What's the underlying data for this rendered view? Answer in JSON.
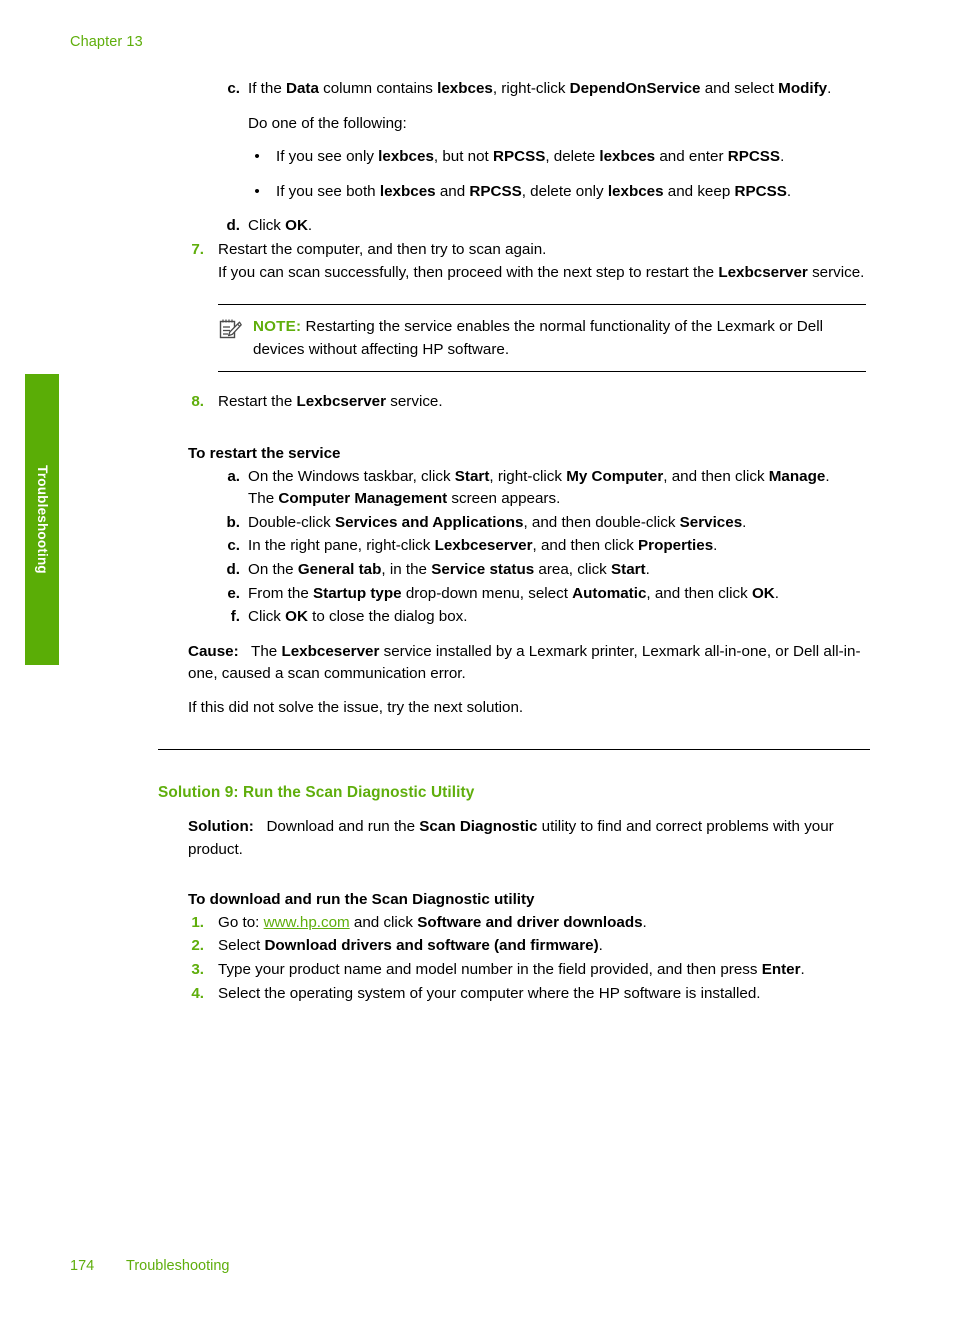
{
  "page": {
    "chapter_header": "Chapter 13",
    "footer_page_number": "174",
    "footer_section": "Troubleshooting",
    "side_tab_label": "Troubleshooting",
    "accent_green": "#5FAE0C",
    "tab_green": "#5AAD06"
  },
  "step_c": {
    "marker": "c.",
    "line1_a": "If the ",
    "line1_b": "Data",
    "line1_c": " column contains ",
    "line1_d": "lexbces",
    "line1_e": ", right-click ",
    "line1_f": "DependOnService",
    "line1_g": " and select ",
    "line1_h": "Modify",
    "line1_i": "."
  },
  "do_one_of": "Do one of the following:",
  "bullets": [
    {
      "marker": "•",
      "a": "If you see only ",
      "b": "lexbces",
      "c": ", but not ",
      "d": "RPCSS",
      "e": ", delete ",
      "f": "lexbces",
      "g": " and enter ",
      "h": "RPCSS",
      "i": "."
    },
    {
      "marker": "•",
      "a": "If you see both ",
      "b": "lexbces",
      "c": " and ",
      "d": "RPCSS",
      "e": ", delete only ",
      "f": "lexbces",
      "g": " and keep ",
      "h": "RPCSS",
      "i": "."
    }
  ],
  "step_d": {
    "marker": "d.",
    "a": "Click ",
    "b": "OK",
    "c": "."
  },
  "step_7": {
    "marker": "7.",
    "text": "Restart the computer, and then try to scan again.",
    "cont_a": "If you can scan successfully, then proceed with the next step to restart the ",
    "cont_b": "Lexbcserver",
    "cont_c": " service."
  },
  "note": {
    "icon": "note-pad-pencil-icon",
    "label": "NOTE:",
    "text": "Restarting the service enables the normal functionality of the Lexmark or Dell devices without affecting HP software."
  },
  "step_8": {
    "marker": "8.",
    "a": "Restart the ",
    "b": "Lexbcserver",
    "c": " service."
  },
  "restart_service": {
    "heading": "To restart the service",
    "items": [
      {
        "marker": "a.",
        "parts": [
          {
            "t": "On the Windows taskbar, click ",
            "bold": false
          },
          {
            "t": "Start",
            "bold": true
          },
          {
            "t": ", right-click ",
            "bold": false
          },
          {
            "t": "My Computer",
            "bold": true
          },
          {
            "t": ", and then click ",
            "bold": false
          },
          {
            "t": "Manage",
            "bold": true
          },
          {
            "t": ".",
            "bold": false
          }
        ],
        "continuation": [
          {
            "t": "The ",
            "bold": false
          },
          {
            "t": "Computer Management",
            "bold": true
          },
          {
            "t": " screen appears.",
            "bold": false
          }
        ]
      },
      {
        "marker": "b.",
        "parts": [
          {
            "t": "Double-click ",
            "bold": false
          },
          {
            "t": "Services and Applications",
            "bold": true
          },
          {
            "t": ", and then double-click ",
            "bold": false
          },
          {
            "t": "Services",
            "bold": true
          },
          {
            "t": ".",
            "bold": false
          }
        ]
      },
      {
        "marker": "c.",
        "parts": [
          {
            "t": "In the right pane, right-click ",
            "bold": false
          },
          {
            "t": "Lexbceserver",
            "bold": true
          },
          {
            "t": ", and then click ",
            "bold": false
          },
          {
            "t": "Properties",
            "bold": true
          },
          {
            "t": ".",
            "bold": false
          }
        ]
      },
      {
        "marker": "d.",
        "parts": [
          {
            "t": "On the ",
            "bold": false
          },
          {
            "t": "General tab",
            "bold": true
          },
          {
            "t": ", in the ",
            "bold": false
          },
          {
            "t": "Service status",
            "bold": true
          },
          {
            "t": " area, click ",
            "bold": false
          },
          {
            "t": "Start",
            "bold": true
          },
          {
            "t": ".",
            "bold": false
          }
        ]
      },
      {
        "marker": "e.",
        "parts": [
          {
            "t": "From the ",
            "bold": false
          },
          {
            "t": "Startup type",
            "bold": true
          },
          {
            "t": " drop-down menu, select ",
            "bold": false
          },
          {
            "t": "Automatic",
            "bold": true
          },
          {
            "t": ", and then click ",
            "bold": false
          },
          {
            "t": "OK",
            "bold": true
          },
          {
            "t": ".",
            "bold": false
          }
        ]
      },
      {
        "marker": "f.",
        "parts": [
          {
            "t": "Click ",
            "bold": false
          },
          {
            "t": "OK",
            "bold": true
          },
          {
            "t": " to close the dialog box.",
            "bold": false
          }
        ]
      }
    ]
  },
  "cause": {
    "label": "Cause:",
    "a": "The ",
    "b": "Lexbceserver",
    "c": " service installed by a Lexmark printer, Lexmark all-in-one, or Dell all-in-one, caused a scan communication error."
  },
  "next_solution": "If this did not solve the issue, try the next solution.",
  "solution9": {
    "heading": "Solution 9: Run the Scan Diagnostic Utility",
    "solution_label": "Solution:",
    "solution_a": "Download and run the ",
    "solution_b": "Scan Diagnostic",
    "solution_c": " utility to find and correct problems with your product.",
    "procedure_heading": "To download and run the Scan Diagnostic utility",
    "steps": [
      {
        "marker": "1.",
        "parts": [
          {
            "t": "Go to: ",
            "bold": false
          },
          {
            "t": "www.hp.com",
            "bold": false,
            "link": true
          },
          {
            "t": " and click ",
            "bold": false
          },
          {
            "t": "Software and driver downloads",
            "bold": true
          },
          {
            "t": ".",
            "bold": false
          }
        ]
      },
      {
        "marker": "2.",
        "parts": [
          {
            "t": "Select ",
            "bold": false
          },
          {
            "t": "Download drivers and software (and firmware)",
            "bold": true
          },
          {
            "t": ".",
            "bold": false
          }
        ]
      },
      {
        "marker": "3.",
        "parts": [
          {
            "t": "Type your product name and model number in the field provided, and then press ",
            "bold": false
          },
          {
            "t": "Enter",
            "bold": true
          },
          {
            "t": ".",
            "bold": false
          }
        ]
      },
      {
        "marker": "4.",
        "parts": [
          {
            "t": "Select the operating system of your computer where the HP software is installed.",
            "bold": false
          }
        ]
      }
    ]
  }
}
